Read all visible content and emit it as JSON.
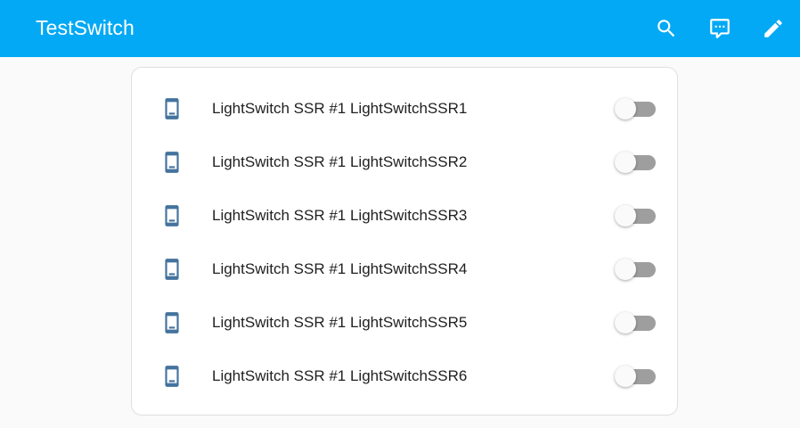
{
  "header": {
    "title": "TestSwitch",
    "color": "#03a9f4",
    "actions": [
      {
        "icon": "search-icon"
      },
      {
        "icon": "assist-chat-icon"
      },
      {
        "icon": "edit-pencil-icon"
      }
    ]
  },
  "entities": [
    {
      "name": "LightSwitch SSR #1 LightSwitchSSR1",
      "icon": "cellphone-icon",
      "state": "off"
    },
    {
      "name": "LightSwitch SSR #1 LightSwitchSSR2",
      "icon": "cellphone-icon",
      "state": "off"
    },
    {
      "name": "LightSwitch SSR #1 LightSwitchSSR3",
      "icon": "cellphone-icon",
      "state": "off"
    },
    {
      "name": "LightSwitch SSR #1 LightSwitchSSR4",
      "icon": "cellphone-icon",
      "state": "off"
    },
    {
      "name": "LightSwitch SSR #1 LightSwitchSSR5",
      "icon": "cellphone-icon",
      "state": "off"
    },
    {
      "name": "LightSwitch SSR #1 LightSwitchSSR6",
      "icon": "cellphone-icon",
      "state": "off"
    }
  ],
  "colors": {
    "icon": "#44739e",
    "toggle_track_off": "#9e9e9e"
  }
}
